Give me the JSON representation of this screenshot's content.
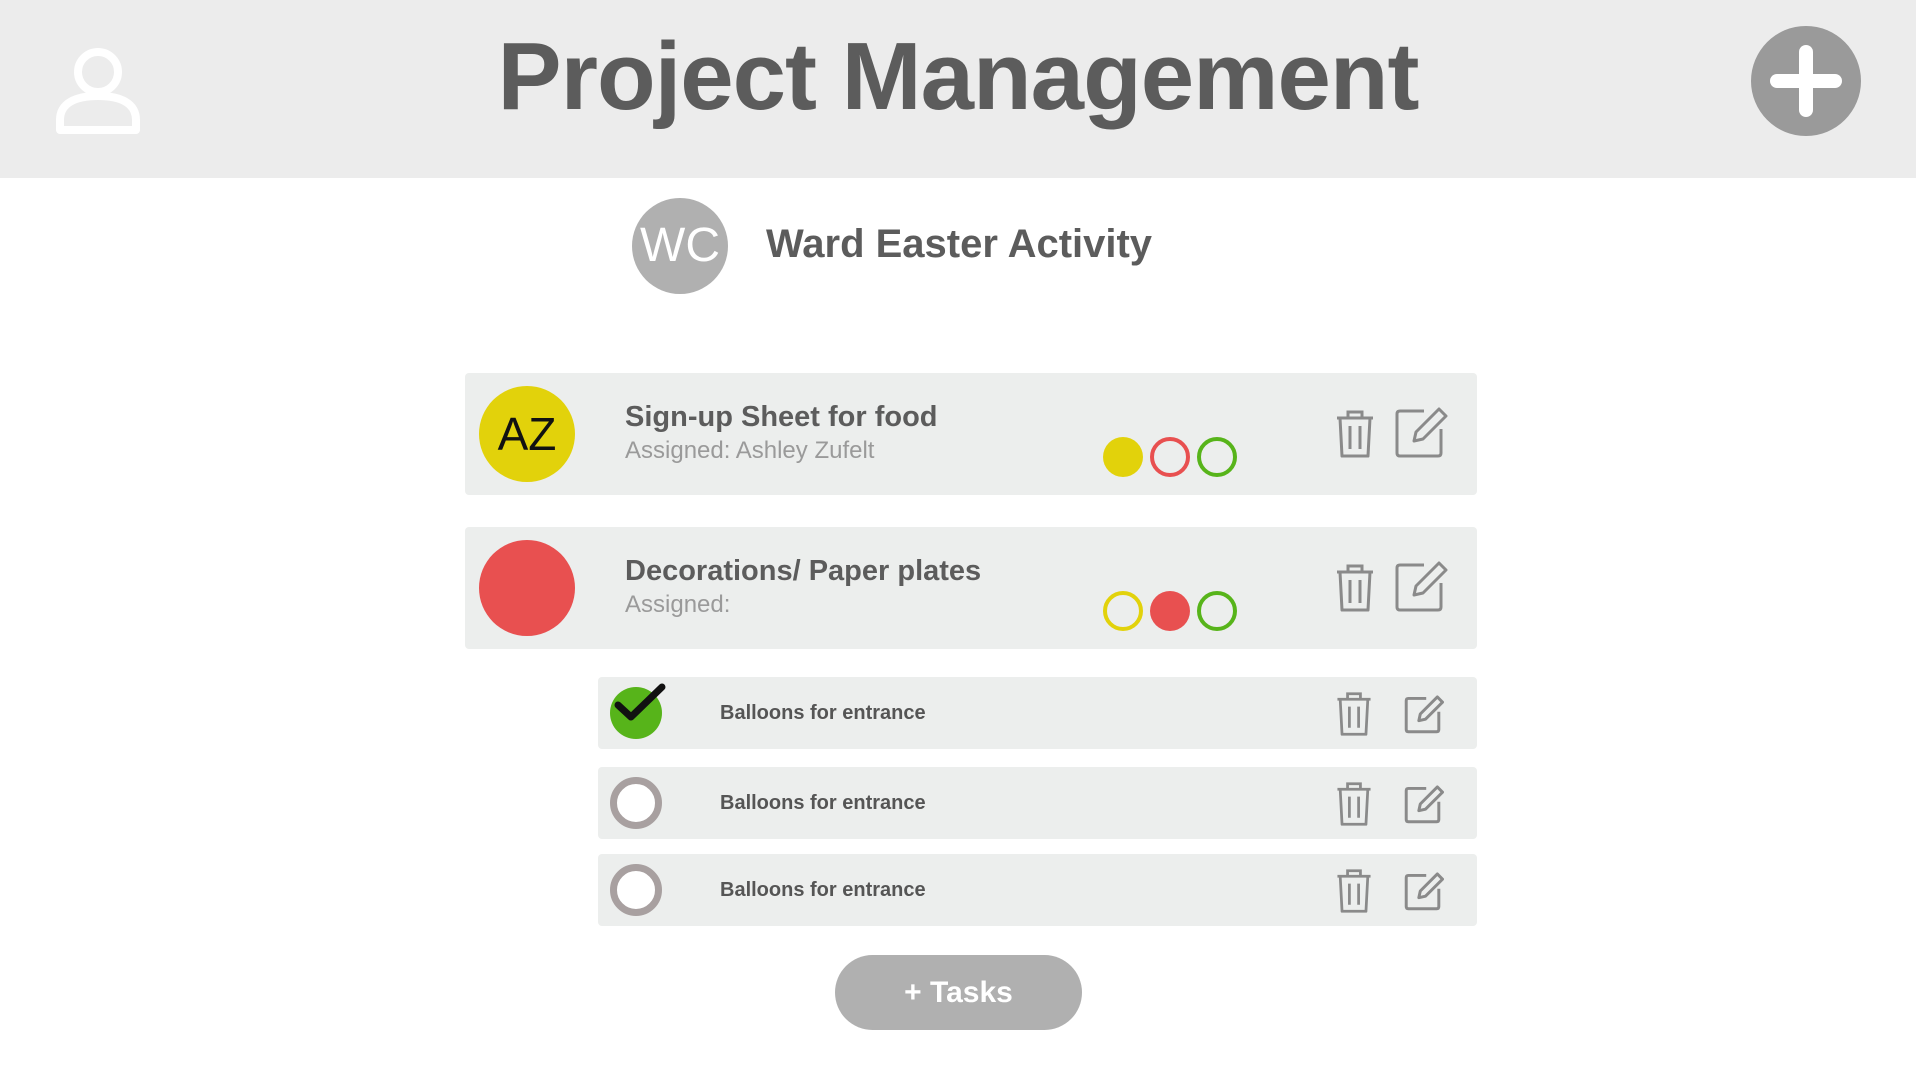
{
  "header": {
    "title": "Project Management",
    "user_icon": "user-icon",
    "add_icon": "plus-icon",
    "add_button_color": "#9a9a9a"
  },
  "project": {
    "initials": "WC",
    "name": "Ward Easter Activity"
  },
  "cards": [
    {
      "initials": "AZ",
      "avatar_color": "#e2d20b",
      "title": "Sign-up Sheet for food",
      "assigned": "Assigned: Ashley Zufelt",
      "status": [
        "yellow-filled",
        "red-outline",
        "green-outline"
      ]
    },
    {
      "initials": "",
      "avatar_color": "#e85050",
      "title": "Decorations/ Paper plates",
      "assigned": "Assigned:",
      "status": [
        "yellow-outline",
        "red-filled",
        "green-outline"
      ]
    }
  ],
  "subtasks": [
    {
      "label": "Balloons for entrance",
      "done": true
    },
    {
      "label": "Balloons for entrance",
      "done": false
    },
    {
      "label": "Balloons for entrance",
      "done": false
    }
  ],
  "add_tasks_label": "+ Tasks",
  "colors": {
    "yellow": "#e2d20b",
    "red": "#e85050",
    "green": "#57b41a",
    "card_bg": "#eceeed",
    "header_bg": "#ececec"
  },
  "icons": {
    "delete": "trash-icon",
    "edit": "edit-icon",
    "check": "checkmark-icon"
  }
}
